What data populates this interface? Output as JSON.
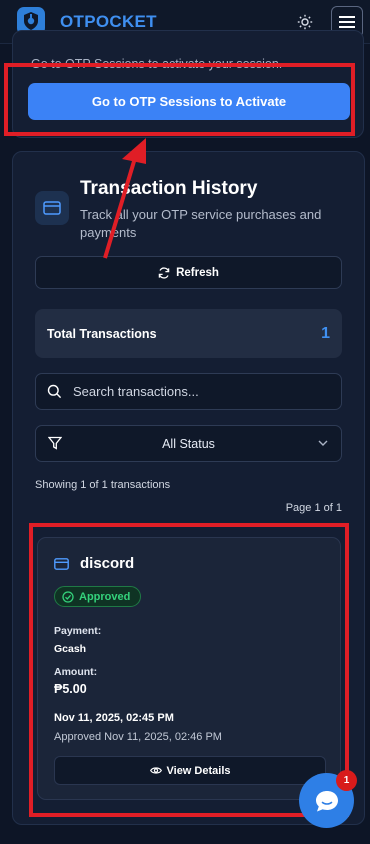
{
  "header": {
    "brand": "OTPOCKET"
  },
  "session_card": {
    "message": "Go to OTP Sessions to activate your session.",
    "activate_button": "Go to OTP Sessions to Activate"
  },
  "history": {
    "title": "Transaction History",
    "subtitle": "Track all your OTP service purchases and payments",
    "refresh_label": "Refresh",
    "total_label": "Total Transactions",
    "total_value": "1",
    "search_placeholder": "Search transactions...",
    "status_filter": "All Status",
    "showing_text": "Showing 1 of 1 transactions",
    "page_info": "Page 1 of 1"
  },
  "transactions": [
    {
      "service": "discord",
      "status": "Approved",
      "payment_label": "Payment:",
      "payment_value": "Gcash",
      "amount_label": "Amount:",
      "amount_value": "₱5.00",
      "date": "Nov 11, 2025, 02:45 PM",
      "approved_text": "Approved Nov 11, 2025, 02:46 PM",
      "view_label": "View Details"
    }
  ],
  "chat": {
    "badge_count": "1"
  },
  "colors": {
    "background": "#0d1526",
    "accent": "#3b82f6",
    "success": "#34d27b",
    "annotation_red": "#e01e26"
  }
}
